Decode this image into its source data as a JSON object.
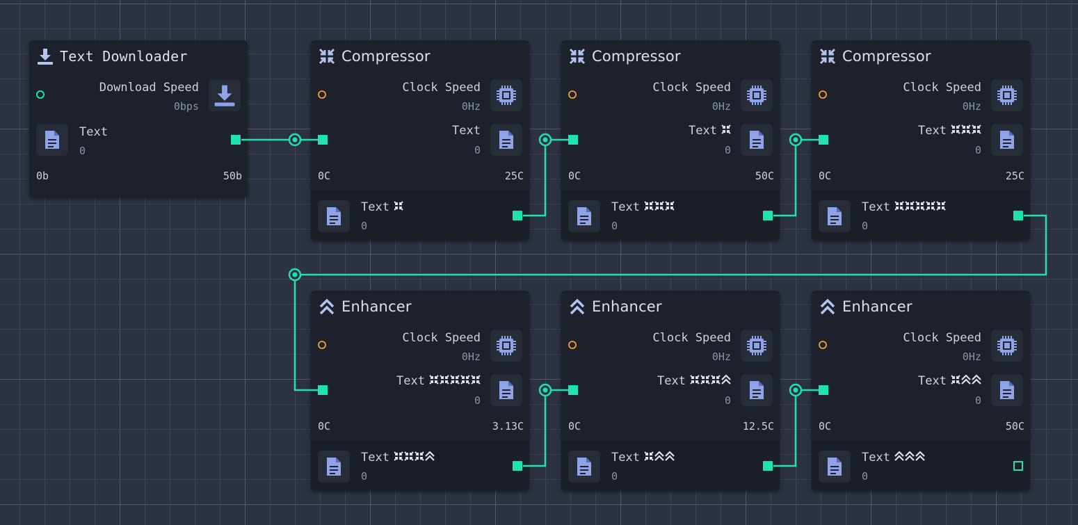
{
  "colors": {
    "accent": "#1ee3b0",
    "warn": "#e8932e",
    "icon": "#8fa4e8"
  },
  "downloader": {
    "title": "Text Downloader",
    "speed_label": "Download Speed",
    "speed_value": "0bps",
    "text_label": "Text",
    "text_value": "0",
    "footer_left": "0b",
    "footer_right": "50b"
  },
  "compressors": [
    {
      "title": "Compressor",
      "clock_label": "Clock Speed",
      "clock_value": "0Hz",
      "in_label": "Text",
      "in_value": "0",
      "footer_left": "0C",
      "footer_right": "25C",
      "out_label": "Text",
      "out_value": "0"
    },
    {
      "title": "Compressor",
      "clock_label": "Clock Speed",
      "clock_value": "0Hz",
      "in_label": "Text",
      "in_value": "0",
      "footer_left": "0C",
      "footer_right": "50C",
      "out_label": "Text",
      "out_value": "0"
    },
    {
      "title": "Compressor",
      "clock_label": "Clock Speed",
      "clock_value": "0Hz",
      "in_label": "Text",
      "in_value": "0",
      "footer_left": "0C",
      "footer_right": "25C",
      "out_label": "Text",
      "out_value": "0"
    }
  ],
  "enhancers": [
    {
      "title": "Enhancer",
      "clock_label": "Clock Speed",
      "clock_value": "0Hz",
      "in_label": "Text",
      "in_value": "0",
      "footer_left": "0C",
      "footer_right": "3.13C",
      "out_label": "Text",
      "out_value": "0"
    },
    {
      "title": "Enhancer",
      "clock_label": "Clock Speed",
      "clock_value": "0Hz",
      "in_label": "Text",
      "in_value": "0",
      "footer_left": "0C",
      "footer_right": "12.5C",
      "out_label": "Text",
      "out_value": "0"
    },
    {
      "title": "Enhancer",
      "clock_label": "Clock Speed",
      "clock_value": "0Hz",
      "in_label": "Text",
      "in_value": "0",
      "footer_left": "0C",
      "footer_right": "50C",
      "out_label": "Text",
      "out_value": "0"
    }
  ],
  "icons": {
    "downloader": "download-icon",
    "compressor": "compress-icon",
    "enhancer": "chevrons-up-icon",
    "clock": "cpu-icon",
    "text": "document-icon"
  }
}
